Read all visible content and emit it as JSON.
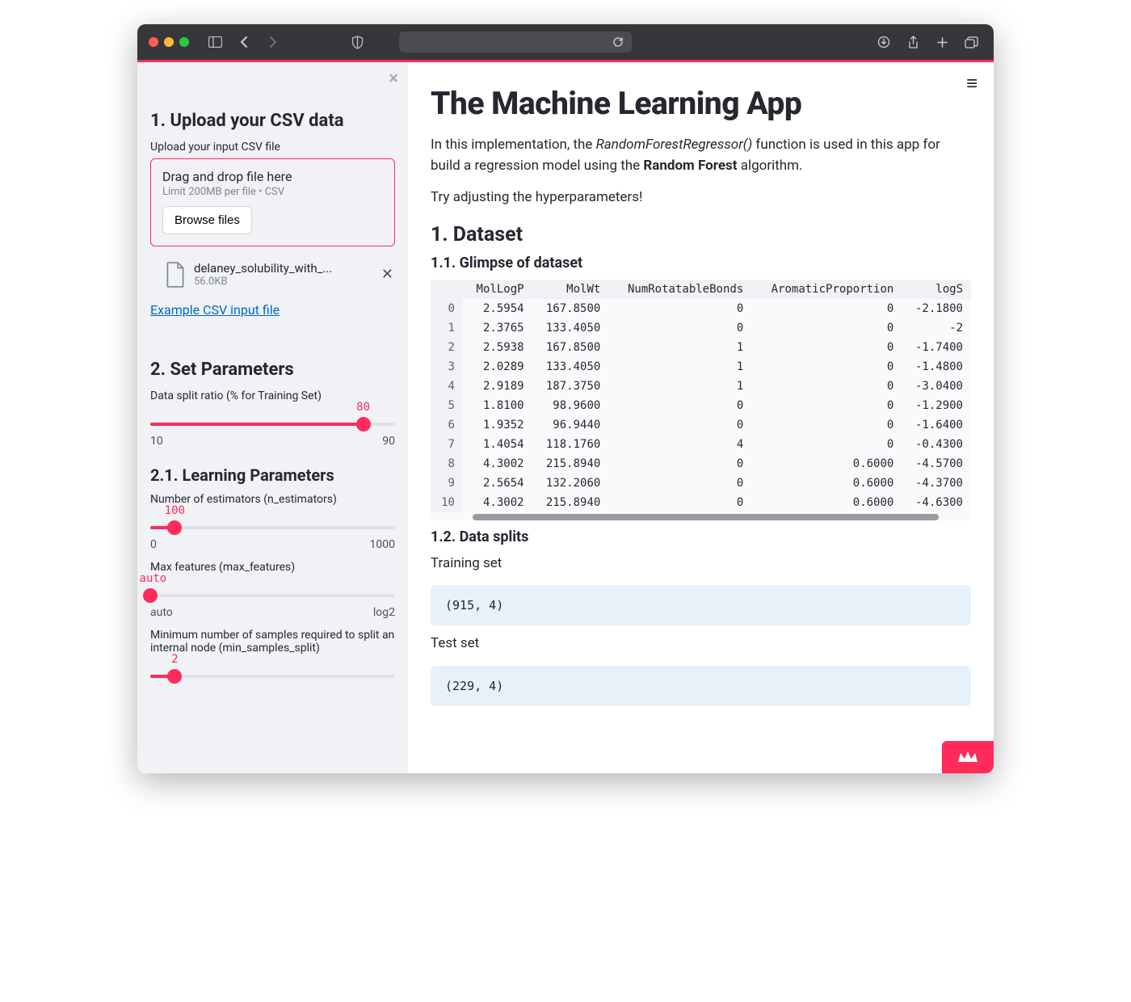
{
  "sidebar": {
    "close_icon": "close",
    "h_upload": "1. Upload your CSV data",
    "upload_label": "Upload your input CSV file",
    "dz_title": "Drag and drop file here",
    "dz_sub": "Limit 200MB per file • CSV",
    "browse": "Browse files",
    "file": {
      "name": "delaney_solubility_with_...",
      "size": "56.0KB"
    },
    "example_link": "Example CSV input file",
    "h_params": "2. Set Parameters",
    "split": {
      "label": "Data split ratio (% for Training Set)",
      "value": "80",
      "min": "10",
      "max": "90",
      "pct": 87
    },
    "h_learn": "2.1. Learning Parameters",
    "n_est": {
      "label": "Number of estimators (n_estimators)",
      "value": "100",
      "min": "0",
      "max": "1000",
      "pct": 10
    },
    "max_feat": {
      "label": "Max features (max_features)",
      "value": "auto",
      "min": "auto",
      "max": "log2",
      "pct": 0
    },
    "min_split": {
      "label": "Minimum number of samples required to split an internal node (min_samples_split)",
      "value": "2",
      "pct": 10
    }
  },
  "main": {
    "title": "The Machine Learning App",
    "intro_a": "In this implementation, the ",
    "intro_em": "RandomForestRegressor()",
    "intro_b": " function is used in this app for build a regression model using the ",
    "intro_strong": "Random Forest",
    "intro_c": " algorithm.",
    "intro2": "Try adjusting the hyperparameters!",
    "h_dataset": "1. Dataset",
    "h_glimpse": "1.1. Glimpse of dataset",
    "table": {
      "columns": [
        "MolLogP",
        "MolWt",
        "NumRotatableBonds",
        "AromaticProportion",
        "logS"
      ],
      "index": [
        "0",
        "1",
        "2",
        "3",
        "4",
        "5",
        "6",
        "7",
        "8",
        "9",
        "10"
      ],
      "rows": [
        [
          "2.5954",
          "167.8500",
          "0",
          "0",
          "-2.1800"
        ],
        [
          "2.3765",
          "133.4050",
          "0",
          "0",
          "-2"
        ],
        [
          "2.5938",
          "167.8500",
          "1",
          "0",
          "-1.7400"
        ],
        [
          "2.0289",
          "133.4050",
          "1",
          "0",
          "-1.4800"
        ],
        [
          "2.9189",
          "187.3750",
          "1",
          "0",
          "-3.0400"
        ],
        [
          "1.8100",
          "98.9600",
          "0",
          "0",
          "-1.2900"
        ],
        [
          "1.9352",
          "96.9440",
          "0",
          "0",
          "-1.6400"
        ],
        [
          "1.4054",
          "118.1760",
          "4",
          "0",
          "-0.4300"
        ],
        [
          "4.3002",
          "215.8940",
          "0",
          "0.6000",
          "-4.5700"
        ],
        [
          "2.5654",
          "132.2060",
          "0",
          "0.6000",
          "-4.3700"
        ],
        [
          "4.3002",
          "215.8940",
          "0",
          "0.6000",
          "-4.6300"
        ]
      ]
    },
    "h_splits": "1.2. Data splits",
    "train_label": "Training set",
    "train_shape": "(915, 4)",
    "test_label": "Test set",
    "test_shape": "(229, 4)"
  }
}
